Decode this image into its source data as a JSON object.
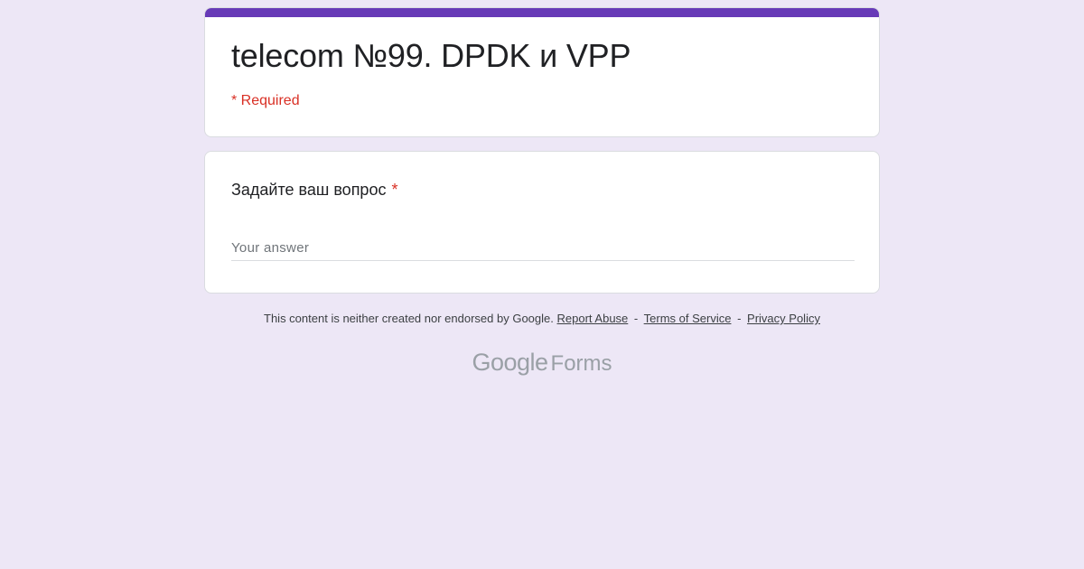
{
  "form": {
    "title": "telecom №99. DPDK и VPP",
    "required_note": "* Required"
  },
  "question": {
    "label": "Задайте ваш вопрос",
    "required_mark": "*",
    "answer_value": "",
    "answer_placeholder": "Your answer"
  },
  "footer": {
    "disclaimer": "This content is neither created nor endorsed by Google.",
    "report_abuse": "Report Abuse",
    "terms": "Terms of Service",
    "privacy": "Privacy Policy",
    "separator": "-"
  },
  "brand": {
    "google": "Google",
    "product": "Forms"
  },
  "colors": {
    "page_background": "#ede7f6",
    "accent": "#673ab7",
    "required": "#d93025"
  }
}
